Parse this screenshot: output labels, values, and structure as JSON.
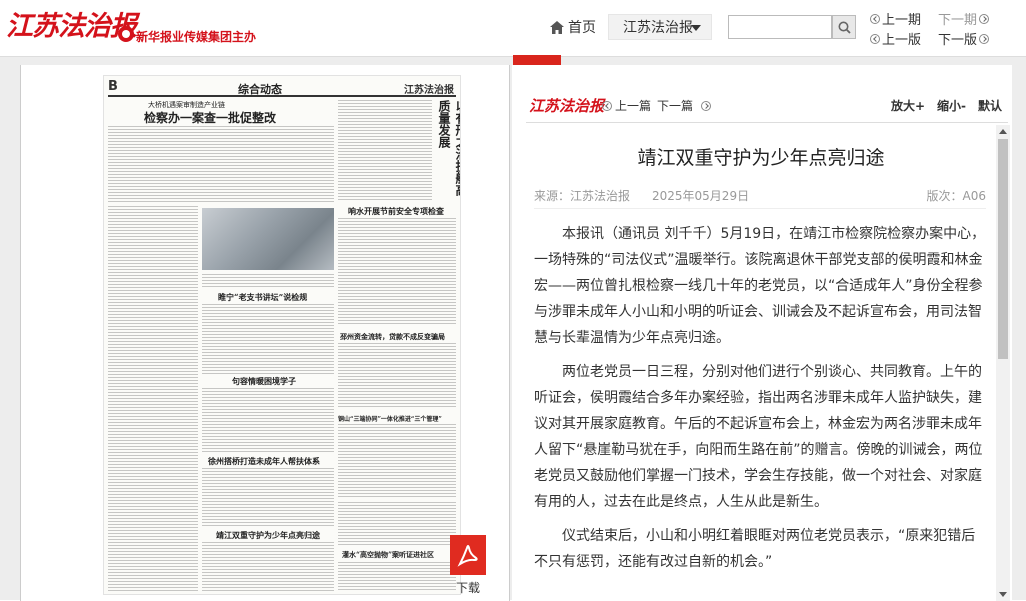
{
  "header": {
    "logo_text": "江苏法治报",
    "group_text": "新华报业传媒集团主办",
    "home_label": "首页",
    "edition_select": "江苏法治报",
    "search_placeholder": "",
    "prev_issue": "上一期",
    "next_issue": "下一期",
    "prev_page": "上一版",
    "next_page": "下一版"
  },
  "paper": {
    "page_letter": "B",
    "section_name": "综合动态",
    "mini_logo": "江苏法治报",
    "headlines": {
      "top_kicker": "大桥机遇案审制造产业链",
      "top_title": "检察办一案查一批促整改",
      "vertical_title": "以有形之治护航高质量发展",
      "h_anti_fraud": "响水开展节前安全专项检查",
      "h_lecture": "睢宁“老支书讲坛”说检规",
      "h_study": "句容情暖困境学子",
      "h_funds": "邳州资金流转，贷款不成反变骗局",
      "h_campus": "铜山“三端协同”一体化推进“三个管理”",
      "h_xuzhou": "徐州搭桥打造未成年人帮扶体系",
      "h_jingjiang": "靖江双重守护为少年点亮归途",
      "h_parabolic": "灌水“高空抛物”案听证进社区"
    },
    "download_label": "下载"
  },
  "panel": {
    "mini_logo": "江苏法治报",
    "prev_article": "上一篇",
    "next_article": "下一篇",
    "zoom_in": "放大+",
    "zoom_out": "缩小-",
    "zoom_default": "默认"
  },
  "article": {
    "title": "靖江双重守护为少年点亮归途",
    "source": "来源：江苏法治报",
    "date": "2025年05月29日",
    "edition": "版次：A06",
    "paragraphs": [
      "本报讯（通讯员 刘千千）5月19日，在靖江市检察院检察办案中心，一场特殊的“司法仪式”温暖举行。该院离退休干部党支部的侯明霞和林金宏——两位曾扎根检察一线几十年的老党员，以“合适成年人”身份全程参与涉罪未成年人小山和小明的听证会、训诫会及不起诉宣布会，用司法智慧与长辈温情为少年点亮归途。",
      "两位老党员一日三程，分别对他们进行个别谈心、共同教育。上午的听证会，侯明霞结合多年办案经验，指出两名涉罪未成年人监护缺失，建议对其开展家庭教育。午后的不起诉宣布会上，林金宏为两名涉罪未成年人留下“悬崖勒马犹在手，向阳而生路在前”的赠言。傍晚的训诫会，两位老党员又鼓励他们掌握一门技术，学会生存技能，做一个对社会、对家庭有用的人，过去在此是终点，人生从此是新生。",
      "仪式结束后，小山和小明红着眼眶对两位老党员表示，“原来犯错后不只有惩罚，还能有改过自新的机会。”"
    ]
  },
  "colors": {
    "brand_red": "#d4121b",
    "pdf_red": "#e02b20"
  }
}
